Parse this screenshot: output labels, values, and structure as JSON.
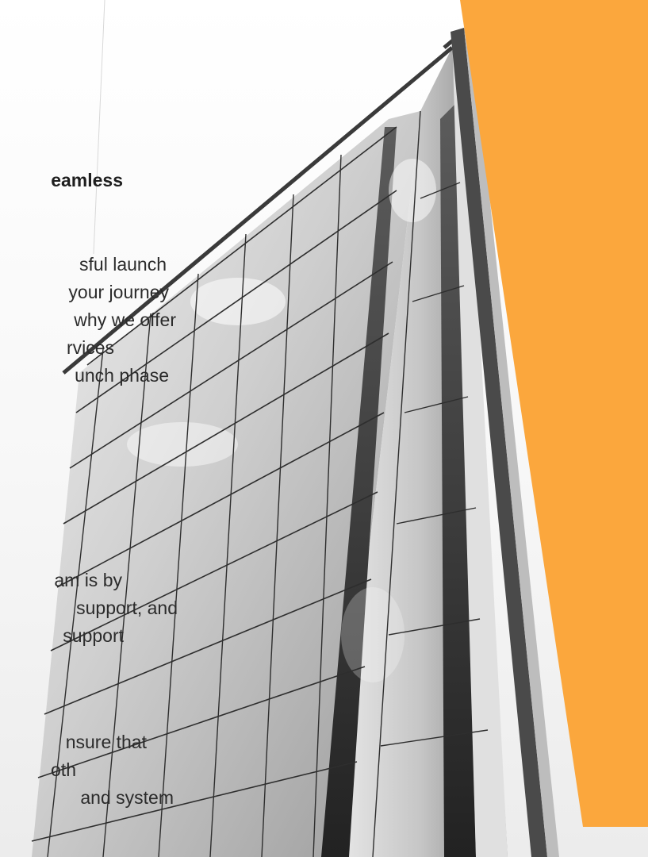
{
  "heading": {
    "fragment": "eamless"
  },
  "paragraph_1": [
    "sful launch",
    "your journey",
    "why we offer",
    "rvices",
    "unch phase"
  ],
  "paragraph_2": [
    "am is by",
    "support, and",
    " support"
  ],
  "paragraph_3": [
    "nsure that",
    "oth",
    "and system"
  ],
  "colors": {
    "accent": "#fba73d",
    "text": "#2b2b2b",
    "glass_dark": "#3a3a3a",
    "glass_light": "#d9d9d9"
  }
}
